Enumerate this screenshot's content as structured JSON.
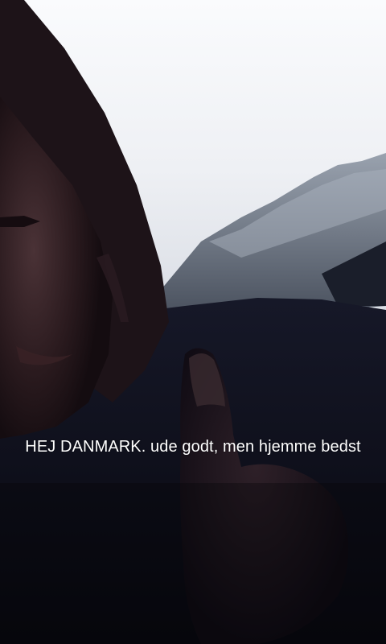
{
  "caption": {
    "text": "HEJ DANMARK. ude godt, men hjemme bedst"
  },
  "colors": {
    "sky": "#f4f4f8",
    "mountain": "#5a6474",
    "dark_clothing": "#10101e",
    "skin_shadow": "#2a1a1c",
    "hair": "#1c1216",
    "caption_text": "#ffffff"
  }
}
